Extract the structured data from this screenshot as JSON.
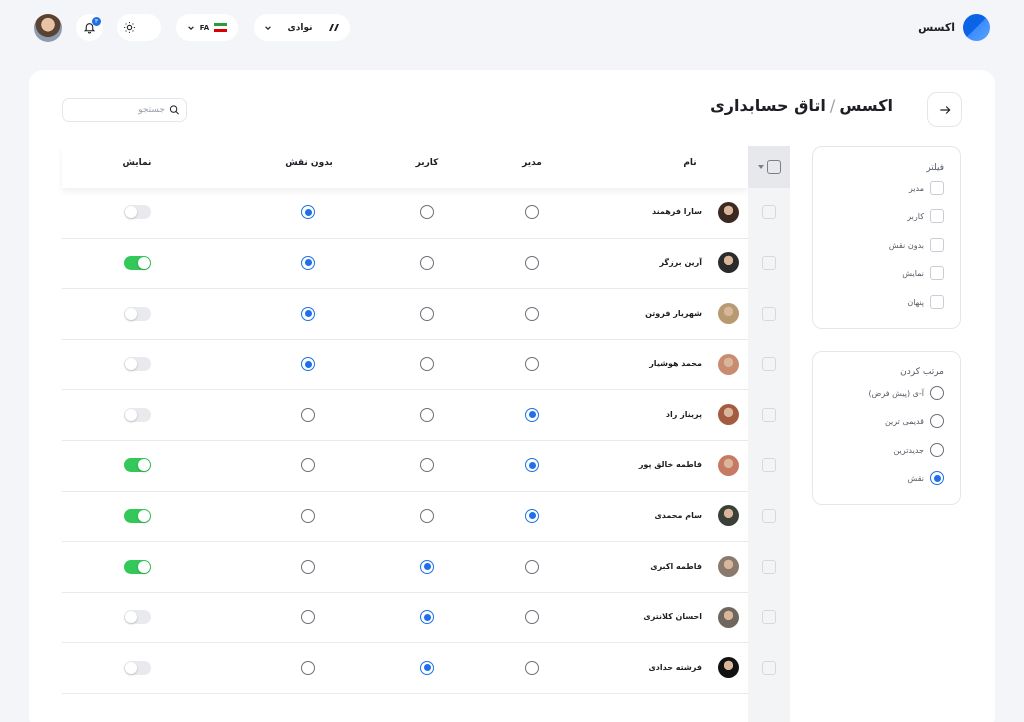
{
  "app": {
    "name": "اکسس"
  },
  "topbar": {
    "site_label": "نوادی",
    "lang_label": "FA",
    "notification_count": "۳"
  },
  "page": {
    "breadcrumb_root": "اکسس",
    "breadcrumb_sep": "/",
    "title": "اتاق حسابداری"
  },
  "search": {
    "placeholder": "جستجو"
  },
  "filter": {
    "title": "فیلتر",
    "options": [
      "مدیر",
      "کاربر",
      "بدون نقش",
      "نمایش",
      "پنهان"
    ]
  },
  "sort": {
    "title": "مرتب کردن",
    "options": [
      "آ-ی (پیش فرض)",
      "قدیمی ترین",
      "جدیدترین",
      "نقش"
    ],
    "selected_index": 3
  },
  "table": {
    "columns": {
      "name": "نام",
      "admin": "مدیر",
      "user": "کاربر",
      "none": "بدون نقش",
      "show": "نمایش"
    },
    "rows": [
      {
        "name": "سارا فرهمند",
        "role": "none",
        "show": false,
        "avatar_color": "#3b2a22"
      },
      {
        "name": "آرین برزگر",
        "role": "none",
        "show": true,
        "avatar_color": "#2b2b2b"
      },
      {
        "name": "شهریار فروتن",
        "role": "none",
        "show": false,
        "avatar_color": "#b79a72"
      },
      {
        "name": "محمد هوشیار",
        "role": "none",
        "show": false,
        "avatar_color": "#c98c6e"
      },
      {
        "name": "پریناز راد",
        "role": "admin",
        "show": false,
        "avatar_color": "#a55b3f"
      },
      {
        "name": "فاطمه خالق پور",
        "role": "admin",
        "show": true,
        "avatar_color": "#c77a63"
      },
      {
        "name": "سام محمدی",
        "role": "admin",
        "show": true,
        "avatar_color": "#3a4038"
      },
      {
        "name": "فاطمه اکبری",
        "role": "user",
        "show": true,
        "avatar_color": "#8a7a6e"
      },
      {
        "name": "احسان کلانتری",
        "role": "user",
        "show": false,
        "avatar_color": "#6f665d"
      },
      {
        "name": "فرشته حدادی",
        "role": "user",
        "show": false,
        "avatar_color": "#111111"
      }
    ]
  },
  "colors": {
    "accent": "#1e6fe8",
    "toggle_on": "#34c759"
  }
}
